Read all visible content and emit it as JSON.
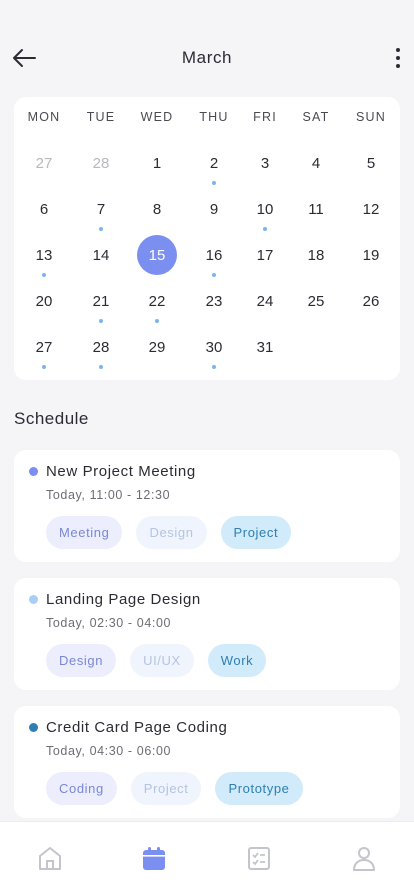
{
  "header": {
    "title": "March"
  },
  "calendar": {
    "weekdays": [
      "MON",
      "TUE",
      "WED",
      "THU",
      "FRI",
      "SAT",
      "SUN"
    ],
    "days": [
      {
        "label": "27",
        "muted": true,
        "event": false
      },
      {
        "label": "28",
        "muted": true,
        "event": false
      },
      {
        "label": "1",
        "muted": false,
        "event": false
      },
      {
        "label": "2",
        "muted": false,
        "event": true
      },
      {
        "label": "3",
        "muted": false,
        "event": false
      },
      {
        "label": "4",
        "muted": false,
        "event": false
      },
      {
        "label": "5",
        "muted": false,
        "event": false
      },
      {
        "label": "6",
        "muted": false,
        "event": false
      },
      {
        "label": "7",
        "muted": false,
        "event": true
      },
      {
        "label": "8",
        "muted": false,
        "event": false
      },
      {
        "label": "9",
        "muted": false,
        "event": false
      },
      {
        "label": "10",
        "muted": false,
        "event": true
      },
      {
        "label": "11",
        "muted": false,
        "event": false
      },
      {
        "label": "12",
        "muted": false,
        "event": false
      },
      {
        "label": "13",
        "muted": false,
        "event": true
      },
      {
        "label": "14",
        "muted": false,
        "event": false
      },
      {
        "label": "15",
        "muted": false,
        "event": false,
        "selected": true
      },
      {
        "label": "16",
        "muted": false,
        "event": true
      },
      {
        "label": "17",
        "muted": false,
        "event": false
      },
      {
        "label": "18",
        "muted": false,
        "event": false
      },
      {
        "label": "19",
        "muted": false,
        "event": false
      },
      {
        "label": "20",
        "muted": false,
        "event": false
      },
      {
        "label": "21",
        "muted": false,
        "event": true
      },
      {
        "label": "22",
        "muted": false,
        "event": true
      },
      {
        "label": "23",
        "muted": false,
        "event": false
      },
      {
        "label": "24",
        "muted": false,
        "event": false
      },
      {
        "label": "25",
        "muted": false,
        "event": false
      },
      {
        "label": "26",
        "muted": false,
        "event": false
      },
      {
        "label": "27",
        "muted": false,
        "event": true
      },
      {
        "label": "28",
        "muted": false,
        "event": true
      },
      {
        "label": "29",
        "muted": false,
        "event": false
      },
      {
        "label": "30",
        "muted": false,
        "event": true
      },
      {
        "label": "31",
        "muted": false,
        "event": false
      }
    ]
  },
  "schedule": {
    "title": "Schedule",
    "events": [
      {
        "title": "New Project Meeting",
        "time": "Today, 11:00 - 12:30",
        "color": "#7b8ff0",
        "tags": [
          "Meeting",
          "Design",
          "Project"
        ]
      },
      {
        "title": "Landing Page Design",
        "time": "Today, 02:30 - 04:00",
        "color": "#a9cdf5",
        "tags": [
          "Design",
          "UI/UX",
          "Work"
        ]
      },
      {
        "title": "Credit Card Page Coding",
        "time": "Today, 04:30 - 06:00",
        "color": "#2f7fb3",
        "tags": [
          "Coding",
          "Project",
          "Prototype"
        ]
      }
    ]
  },
  "bottom_nav": {
    "items": [
      {
        "icon": "home-icon",
        "active": false
      },
      {
        "icon": "calendar-icon",
        "active": true
      },
      {
        "icon": "tasks-icon",
        "active": false
      },
      {
        "icon": "profile-icon",
        "active": false
      }
    ],
    "active_color": "#7b8ff0",
    "inactive_color": "#c4c4cc"
  }
}
